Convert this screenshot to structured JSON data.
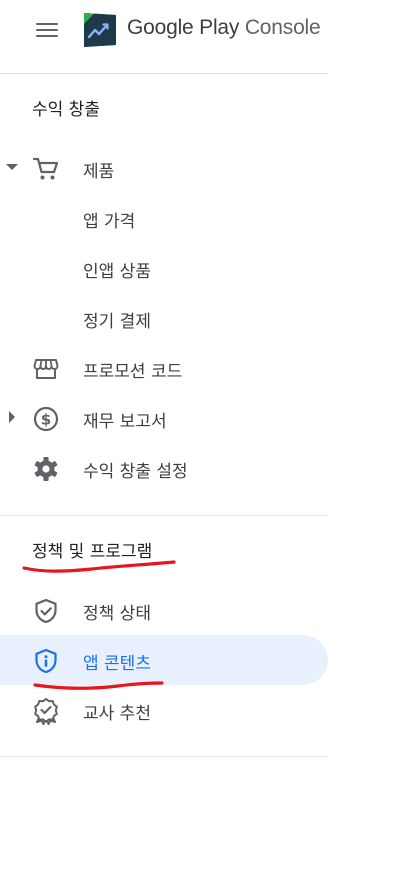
{
  "header": {
    "brand_primary": "Google Play",
    "brand_secondary": "Console",
    "menu_icon": "hamburger-menu-icon"
  },
  "monetize": {
    "title": "수익 창출",
    "items": [
      {
        "label": "제품",
        "icon": "shopping-cart-icon",
        "expanded": true
      },
      {
        "label": "앱 가격"
      },
      {
        "label": "인앱 상품"
      },
      {
        "label": "정기 결제"
      },
      {
        "label": "프로모션 코드",
        "icon": "storefront-icon"
      },
      {
        "label": "재무 보고서",
        "icon": "dollar-circle-icon",
        "expanded": false
      },
      {
        "label": "수익 창출 설정",
        "icon": "gear-icon"
      }
    ]
  },
  "policy": {
    "title": "정책 및 프로그램",
    "items": [
      {
        "label": "정책 상태",
        "icon": "shield-check-icon"
      },
      {
        "label": "앱 콘텐츠",
        "icon": "shield-info-icon",
        "active": true
      },
      {
        "label": "교사 추천",
        "icon": "badge-check-icon"
      }
    ]
  },
  "colors": {
    "accent": "#1a73e8",
    "active_bg": "#e8f0fe",
    "text": "#3c4043",
    "icon": "#5f6368",
    "annotation": "#e8141e"
  }
}
